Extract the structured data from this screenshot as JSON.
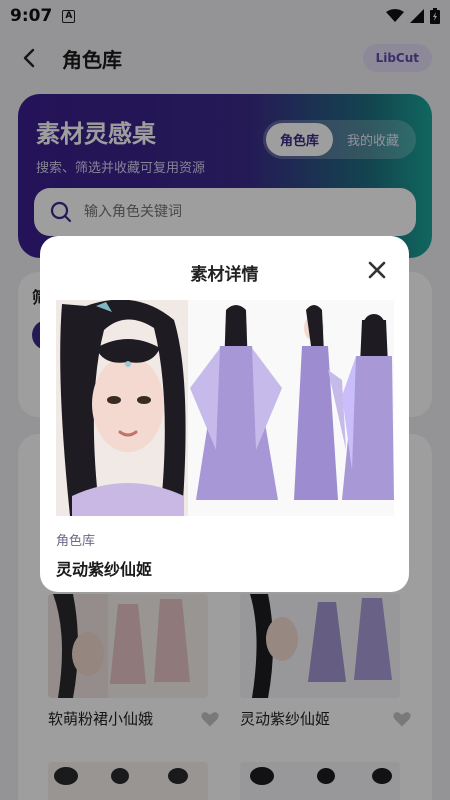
{
  "status_bar": {
    "time": "9:07",
    "notification_letter": "A"
  },
  "header": {
    "title": "角色库",
    "badge": "LibCut"
  },
  "hero": {
    "title": "素材灵感桌",
    "subtitle": "搜索、筛选并收藏可复用资源",
    "tabs": [
      {
        "label": "角色库",
        "active": true
      },
      {
        "label": "我的收藏",
        "active": false
      }
    ],
    "search_placeholder": "输入角色关键词"
  },
  "filter": {
    "title_fragment": "筛"
  },
  "grid": {
    "items": [
      {
        "label": "软萌粉裙小仙娥",
        "favorited": false
      },
      {
        "label": "灵动紫纱仙姬",
        "favorited": false
      }
    ]
  },
  "modal": {
    "title": "素材详情",
    "category": "角色库",
    "name": "灵动紫纱仙姬"
  },
  "colors": {
    "accent": "#3b2a8c",
    "hero_gradient_start": "#3a1f8e",
    "hero_gradient_end": "#1aa69a",
    "badge_bg": "#e4ddf6"
  },
  "icons": [
    "back-arrow-icon",
    "search-icon",
    "heart-icon",
    "close-icon",
    "wifi-icon",
    "signal-icon",
    "battery-icon"
  ]
}
